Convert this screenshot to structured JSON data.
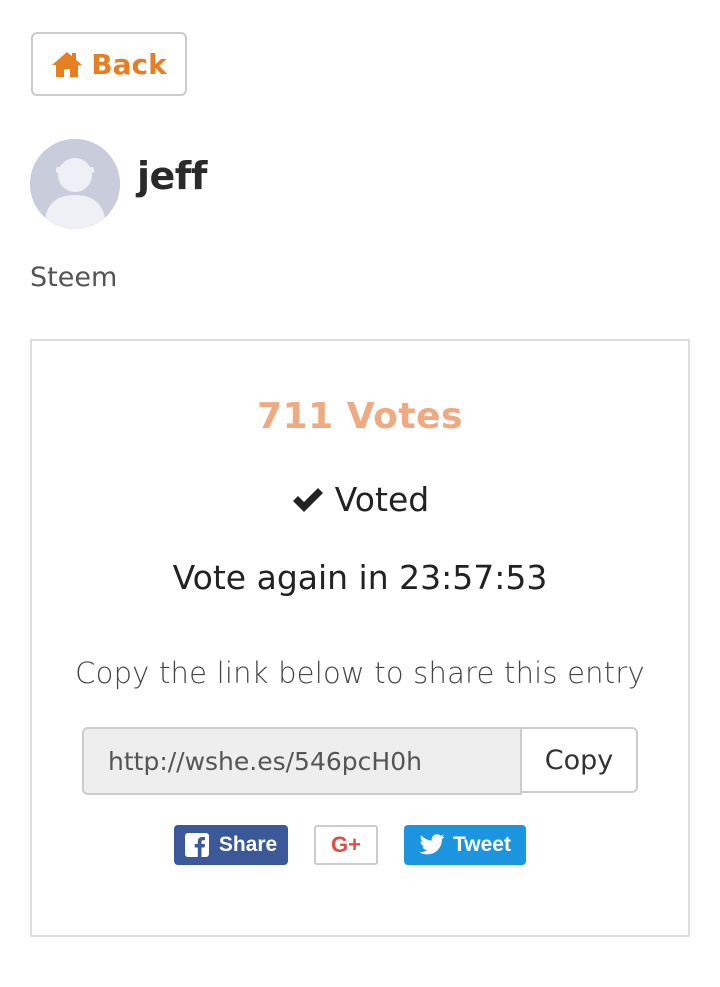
{
  "header": {
    "back_label": "Back"
  },
  "profile": {
    "username": "jeff",
    "category": "Steem"
  },
  "entry": {
    "votes_label": "711 Votes",
    "voted_label": "Voted",
    "vote_again_label": "Vote again in 23:57:53",
    "copy_hint": "Copy the link below to share this entry",
    "share_link": "http://wshe.es/546pcH0h",
    "copy_label": "Copy"
  },
  "share": {
    "facebook_label": "Share",
    "gplus_label": "G+",
    "twitter_label": "Tweet"
  },
  "icons": {
    "back": "home-icon",
    "voted": "check-icon",
    "facebook": "facebook-icon",
    "twitter": "twitter-icon"
  },
  "colors": {
    "accent": "#e67e22",
    "votes": "#f0aa82",
    "facebook": "#3b5998",
    "twitter": "#1b95e0",
    "gplus": "#dc4e41"
  }
}
